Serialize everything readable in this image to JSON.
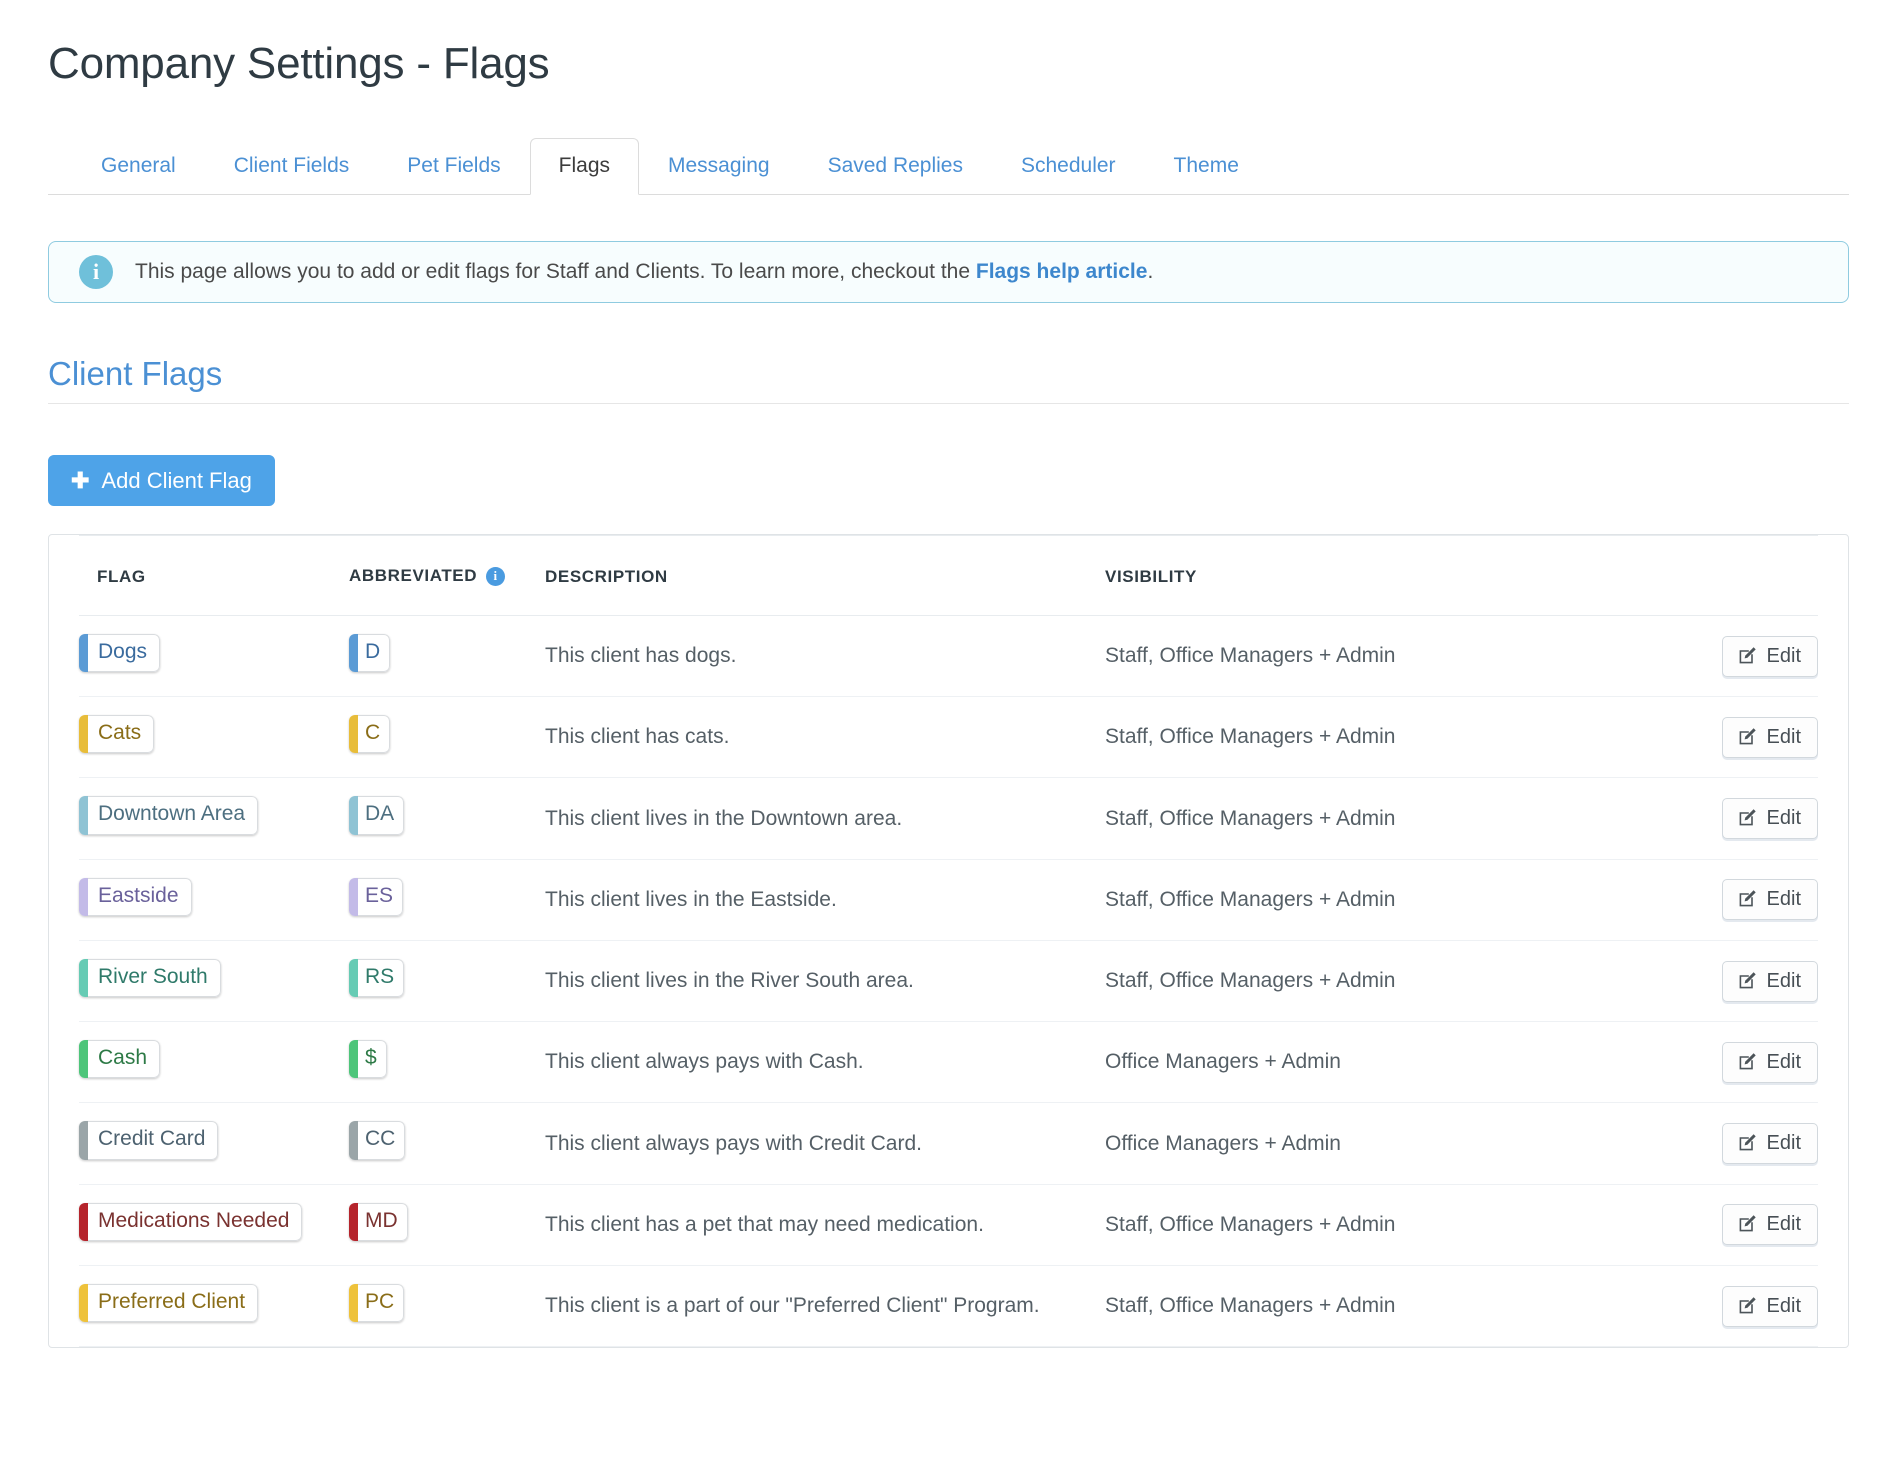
{
  "page": {
    "title": "Company Settings - Flags"
  },
  "tabs": [
    {
      "label": "General",
      "active": false
    },
    {
      "label": "Client Fields",
      "active": false
    },
    {
      "label": "Pet Fields",
      "active": false
    },
    {
      "label": "Flags",
      "active": true
    },
    {
      "label": "Messaging",
      "active": false
    },
    {
      "label": "Saved Replies",
      "active": false
    },
    {
      "label": "Scheduler",
      "active": false
    },
    {
      "label": "Theme",
      "active": false
    }
  ],
  "info_banner": {
    "icon": "info-circle-icon",
    "text_before": "This page allows you to add or edit flags for Staff and Clients. To learn more, checkout the ",
    "link_text": "Flags help article",
    "text_after": "."
  },
  "section": {
    "heading": "Client Flags",
    "add_button_label": "Add Client Flag",
    "add_button_icon": "plus-icon",
    "add_button_color": "#4ea3e8"
  },
  "table": {
    "columns": [
      "FLAG",
      "ABBREVIATED",
      "DESCRIPTION",
      "VISIBILITY"
    ],
    "abbreviated_info_icon": "info-circle-icon",
    "edit_label": "Edit",
    "edit_icon": "pencil-square-icon",
    "rows": [
      {
        "flag": "Dogs",
        "abbr": "D",
        "color": "#5b9bd5",
        "text_color": "#3a6b9e",
        "description": "This client has dogs.",
        "visibility": "Staff, Office Managers + Admin"
      },
      {
        "flag": "Cats",
        "abbr": "C",
        "color": "#e8bd3a",
        "text_color": "#8a6d18",
        "description": "This client has cats.",
        "visibility": "Staff, Office Managers + Admin"
      },
      {
        "flag": "Downtown Area",
        "abbr": "DA",
        "color": "#8fc3d4",
        "text_color": "#4d6f80",
        "description": "This client lives in the Downtown area.",
        "visibility": "Staff, Office Managers + Admin"
      },
      {
        "flag": "Eastside",
        "abbr": "ES",
        "color": "#c3bbe8",
        "text_color": "#6a619b",
        "description": "This client lives in the Eastside.",
        "visibility": "Staff, Office Managers + Admin"
      },
      {
        "flag": "River South",
        "abbr": "RS",
        "color": "#66cbb4",
        "text_color": "#2f7a6a",
        "description": "This client lives in the River South area.",
        "visibility": "Staff, Office Managers + Admin"
      },
      {
        "flag": "Cash",
        "abbr": "$",
        "color": "#4ec57a",
        "text_color": "#2d7a46",
        "description": "This client always pays with Cash.",
        "visibility": "Office Managers + Admin"
      },
      {
        "flag": "Credit Card",
        "abbr": "CC",
        "color": "#9aa5a8",
        "text_color": "#4d6270",
        "description": "This client always pays with Credit Card.",
        "visibility": "Office Managers + Admin"
      },
      {
        "flag": "Medications Needed",
        "abbr": "MD",
        "color": "#b5242c",
        "text_color": "#7a3230",
        "description": "This client has a pet that may need medication.",
        "visibility": "Staff, Office Managers + Admin"
      },
      {
        "flag": "Preferred Client",
        "abbr": "PC",
        "color": "#eec23b",
        "text_color": "#8a6d18",
        "description": "This client is a part of our \"Preferred Client\" Program.",
        "visibility": "Staff, Office Managers + Admin"
      }
    ]
  }
}
